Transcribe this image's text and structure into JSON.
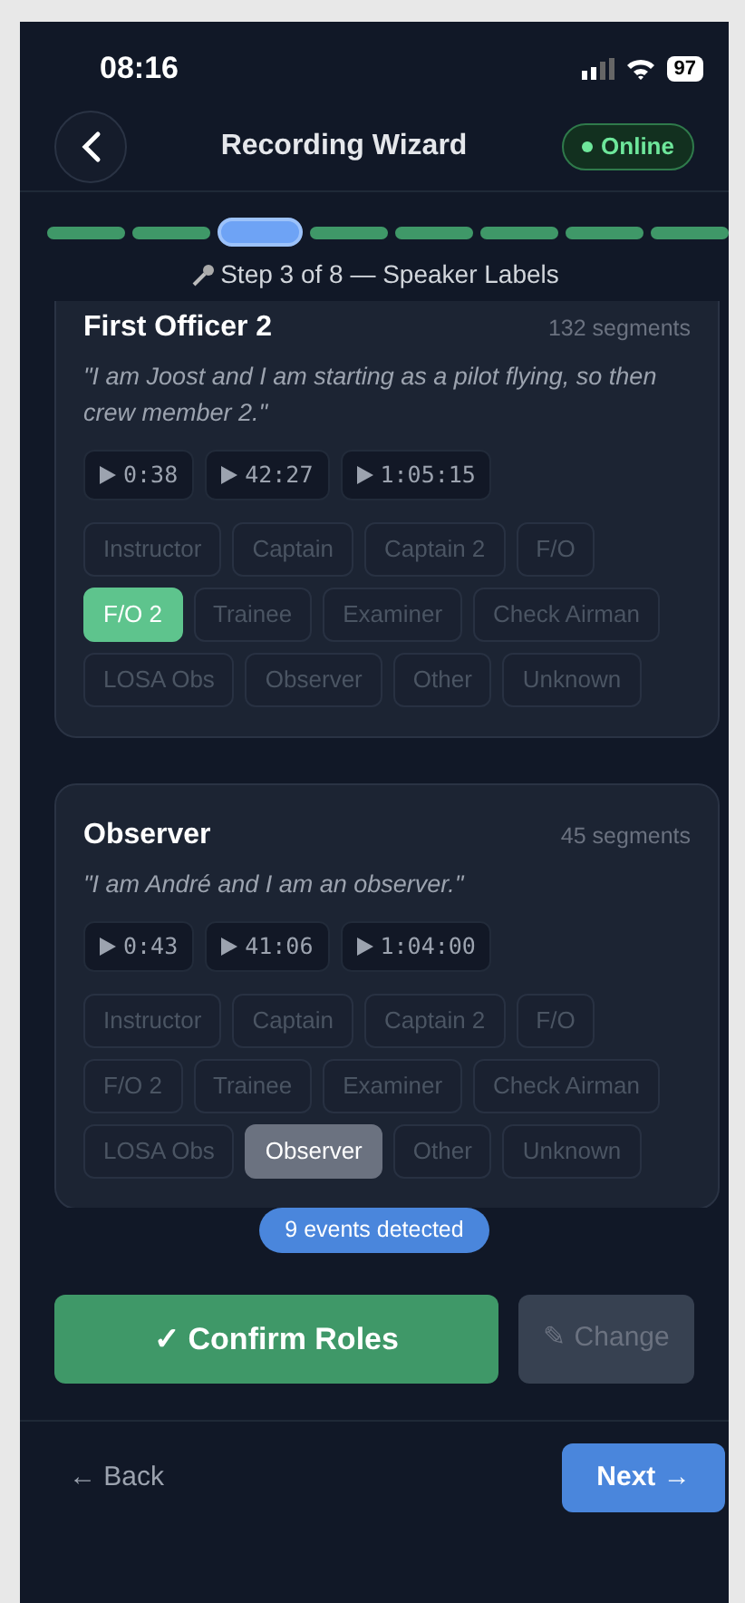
{
  "status_bar": {
    "time": "08:16",
    "battery": "97"
  },
  "header": {
    "title": "Recording Wizard",
    "status": "Online",
    "online": true
  },
  "progress": {
    "steps": [
      {
        "selected": false
      },
      {
        "selected": false
      },
      {
        "selected": true
      },
      {
        "selected": false
      },
      {
        "selected": false
      },
      {
        "selected": false
      },
      {
        "selected": false
      },
      {
        "selected": false
      }
    ],
    "label": "Step 3 of 8 — Speaker Labels"
  },
  "speakers": [
    {
      "name": "First Officer 2",
      "segments": "132 segments",
      "quote": "\"I am Joost and I am starting as a pilot flying, so then crew member 2.\"",
      "confirmed": true,
      "clips": [
        "0:38",
        "42:27",
        "1:05:15"
      ],
      "roles": [
        {
          "label": "Instructor",
          "selected": false
        },
        {
          "label": "Captain",
          "selected": false
        },
        {
          "label": "Captain 2",
          "selected": false
        },
        {
          "label": "F/O",
          "selected": false
        },
        {
          "label": "F/O 2",
          "selected": true
        },
        {
          "label": "Trainee",
          "selected": false
        },
        {
          "label": "Examiner",
          "selected": false
        },
        {
          "label": "Check Airman",
          "selected": false
        },
        {
          "label": "LOSA Obs",
          "selected": false
        },
        {
          "label": "Observer",
          "selected": false
        },
        {
          "label": "Other",
          "selected": false
        },
        {
          "label": "Unknown",
          "selected": false
        }
      ]
    },
    {
      "name": "Observer",
      "segments": "45 segments",
      "quote": "\"I am André and I am an observer.\"",
      "confirmed": false,
      "clips": [
        "0:43",
        "41:06",
        "1:04:00"
      ],
      "roles": [
        {
          "label": "Instructor",
          "selected": false
        },
        {
          "label": "Captain",
          "selected": false
        },
        {
          "label": "Captain 2",
          "selected": false
        },
        {
          "label": "F/O",
          "selected": false
        },
        {
          "label": "F/O 2",
          "selected": false
        },
        {
          "label": "Trainee",
          "selected": false
        },
        {
          "label": "Examiner",
          "selected": false
        },
        {
          "label": "Check Airman",
          "selected": false
        },
        {
          "label": "LOSA Obs",
          "selected": false
        },
        {
          "label": "Observer",
          "selected": true
        },
        {
          "label": "Other",
          "selected": false
        },
        {
          "label": "Unknown",
          "selected": false
        }
      ]
    }
  ],
  "events_badge": "9 events detected",
  "actions": {
    "confirm": "✓ Confirm Roles",
    "change": "✎ Change",
    "change_disabled": true
  },
  "footer": {
    "back": "← Back",
    "next": "Next →"
  }
}
